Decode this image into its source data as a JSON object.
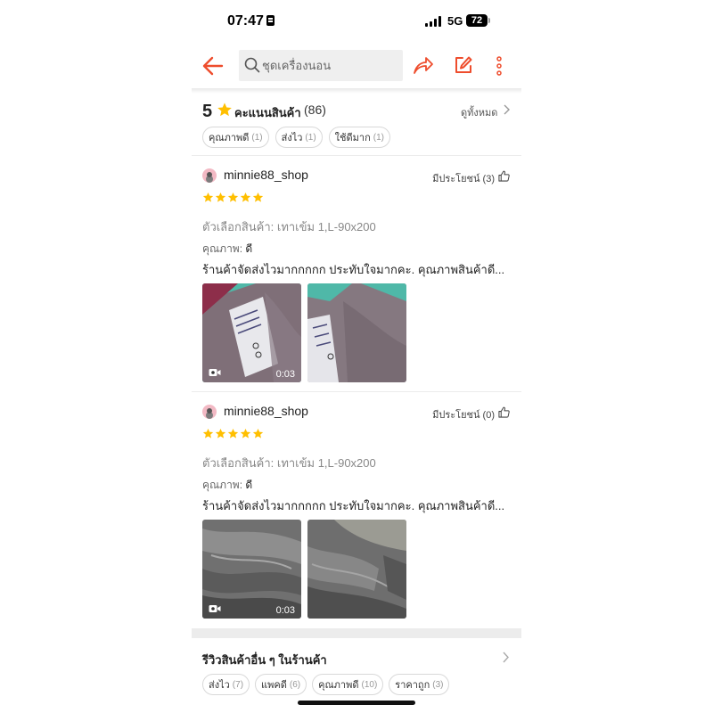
{
  "status_bar": {
    "time": "07:47",
    "network": "5G",
    "battery": "72"
  },
  "search": {
    "placeholder": "ชุดเครื่องนอน"
  },
  "colors": {
    "accent": "#ee4d2d",
    "star": "#ffbf00"
  },
  "icons": {
    "back": "arrow-left-icon",
    "search": "search-icon",
    "share": "share-icon",
    "edit": "edit-icon",
    "more": "more-vertical-icon",
    "star": "star-icon",
    "thumb": "thumbs-up-icon",
    "video": "video-camera-icon",
    "chevron": "chevron-right-icon"
  },
  "rating": {
    "score": "5",
    "label": "คะแนนสินค้า",
    "count": "(86)",
    "see_all": "ดูทั้งหมด",
    "tags": [
      {
        "label": "คุณภาพดี",
        "count": "(1)"
      },
      {
        "label": "ส่งไว",
        "count": "(1)"
      },
      {
        "label": "ใช้ดีมาก",
        "count": "(1)"
      }
    ]
  },
  "reviews": [
    {
      "username": "minnie88_shop",
      "helpful": "มีประโยชน์ (3)",
      "stars": 5,
      "variant": "ตัวเลือกสินค้า: เทาเข้ม 1,L-90x200",
      "quality_label": "คุณภาพ:",
      "quality_value": "ดี",
      "comment": "ร้านค้าจัดส่งไวมากกกกก ประทับใจมากคะ. คุณภาพสินค้าดี...",
      "video_duration": "0:03"
    },
    {
      "username": "minnie88_shop",
      "helpful": "มีประโยชน์ (0)",
      "stars": 5,
      "variant": "ตัวเลือกสินค้า: เทาเข้ม 1,L-90x200",
      "quality_label": "คุณภาพ:",
      "quality_value": "ดี",
      "comment": "ร้านค้าจัดส่งไวมากกกกก ประทับใจมากคะ. คุณภาพสินค้าดี...",
      "video_duration": "0:03"
    }
  ],
  "other_reviews": {
    "title": "รีวิวสินค้าอื่น ๆ ในร้านค้า",
    "tags": [
      {
        "label": "ส่งไว",
        "count": "(7)"
      },
      {
        "label": "แพคดี",
        "count": "(6)"
      },
      {
        "label": "คุณภาพดี",
        "count": "(10)"
      },
      {
        "label": "ราคาถูก",
        "count": "(3)"
      }
    ]
  }
}
